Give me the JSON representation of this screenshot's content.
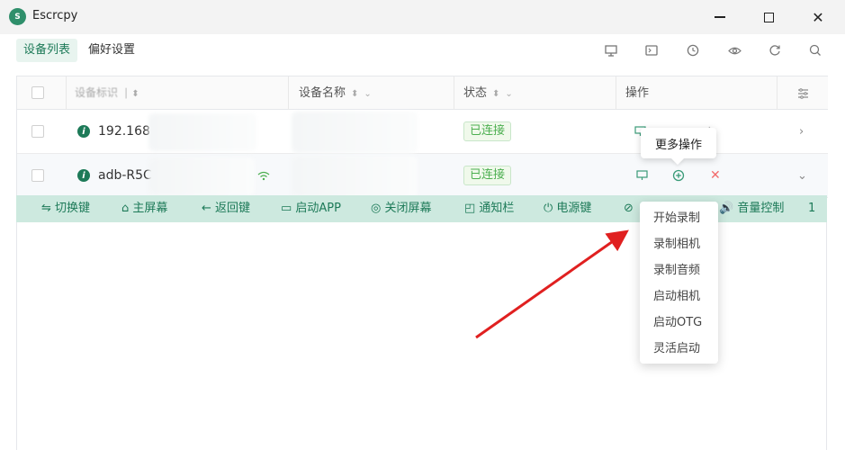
{
  "window": {
    "title": "Escrcpy",
    "controls": {
      "minimize": "minimize-icon",
      "maximize": "maximize-icon",
      "close": "✕"
    }
  },
  "tabs": [
    {
      "label": "设备列表",
      "active": true
    },
    {
      "label": "偏好设置",
      "active": false
    }
  ],
  "toolbar_icons": [
    "monitor-icon",
    "terminal-icon",
    "clock-icon",
    "eye-icon",
    "refresh-icon",
    "search-icon"
  ],
  "table": {
    "columns": {
      "serial": "设备标识",
      "name": "设备名称",
      "status": "状态",
      "actions": "操作"
    },
    "rows": [
      {
        "id": "192.168",
        "status": "已连接",
        "wifi": false
      },
      {
        "id": "adb-R5C",
        "status": "已连接",
        "wifi": true
      }
    ]
  },
  "control_bar": {
    "items": [
      {
        "label": "⇋ 切换键"
      },
      {
        "label": "⌂ 主屏幕"
      },
      {
        "label": "← 返回键"
      },
      {
        "label": "▭ 启动APP"
      },
      {
        "label": "◎ 关闭屏幕"
      },
      {
        "label": "◰ 通知栏"
      },
      {
        "label": "⏻ 电源键"
      },
      {
        "label": "⊘"
      },
      {
        "label": "🔊 音量控制"
      },
      {
        "label": "1"
      }
    ]
  },
  "tooltip": {
    "text": "更多操作"
  },
  "menu": {
    "items": [
      "开始录制",
      "录制相机",
      "录制音频",
      "启动相机",
      "启动OTG",
      "灵活启动"
    ]
  },
  "colors": {
    "accent": "#1d7a58",
    "control_bar_bg": "#cde9df",
    "status_green": "#4caf50",
    "arrow_red": "#e02020"
  }
}
